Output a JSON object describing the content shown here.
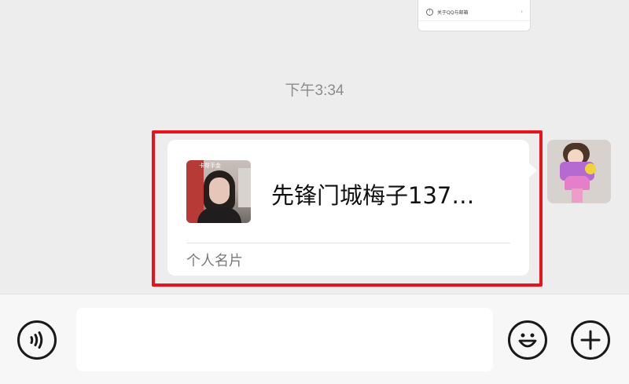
{
  "top_card": {
    "label": "关于QQ与邮箱",
    "chevron": "›"
  },
  "timestamp": "下午3:34",
  "contact_card": {
    "name": "先锋门城梅子137…",
    "type_label": "个人名片",
    "avatar_overlay_text": "卡帮手金"
  },
  "input_bar": {
    "text_value": ""
  },
  "colors": {
    "highlight": "#e8141d",
    "background": "#ededed"
  },
  "icons": [
    "voice-icon",
    "emoji-icon",
    "plus-icon"
  ]
}
